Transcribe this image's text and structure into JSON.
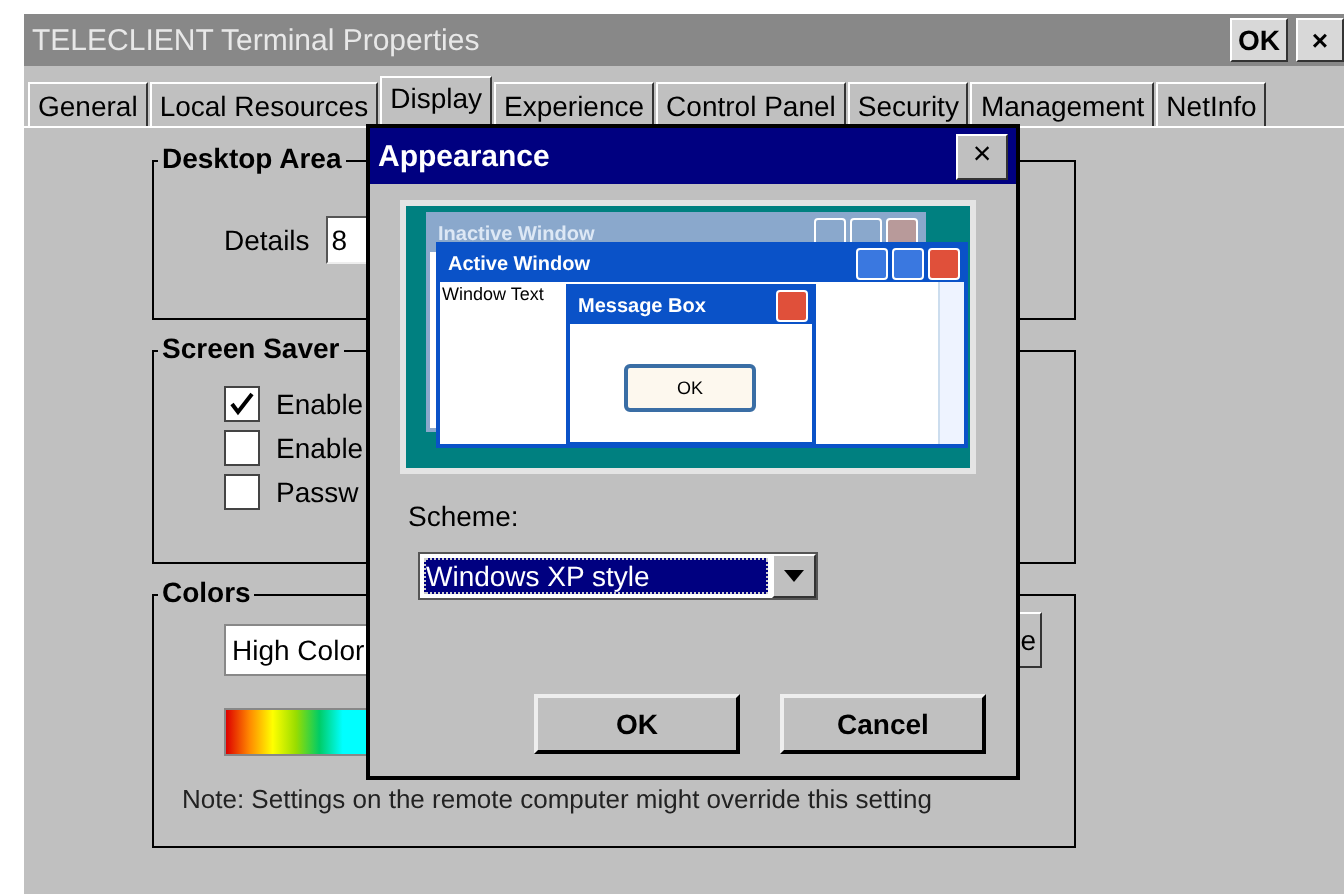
{
  "window": {
    "title": "TELECLIENT Terminal Properties",
    "ok_button": "OK",
    "close_button": "×"
  },
  "tabs": [
    {
      "label": "General",
      "selected": false
    },
    {
      "label": "Local Resources",
      "selected": false
    },
    {
      "label": "Display",
      "selected": true
    },
    {
      "label": "Experience",
      "selected": false
    },
    {
      "label": "Control Panel",
      "selected": false
    },
    {
      "label": "Security",
      "selected": false
    },
    {
      "label": "Management",
      "selected": false
    },
    {
      "label": "NetInfo",
      "selected": false
    }
  ],
  "desktop_area": {
    "label": "Desktop Area",
    "details_label": "Details",
    "details_value": "8"
  },
  "screen_saver": {
    "label": "Screen Saver",
    "options": [
      {
        "label": "Enable",
        "checked": true
      },
      {
        "label": "Enable",
        "checked": false
      },
      {
        "label": "Passw",
        "checked": false
      }
    ]
  },
  "colors": {
    "label": "Colors",
    "color_depth": "High Color",
    "button_fragment": "e",
    "note": "Note: Settings on the remote computer might override this setting"
  },
  "dialog": {
    "title": "Appearance",
    "close_button": "×",
    "preview": {
      "inactive_title": "Inactive Window",
      "active_title": "Active Window",
      "window_text": "Window Text",
      "message_title": "Message Box",
      "message_button": "OK"
    },
    "scheme_label": "Scheme:",
    "scheme_value": "Windows XP style",
    "buttons": [
      "OK",
      "Cancel"
    ]
  }
}
